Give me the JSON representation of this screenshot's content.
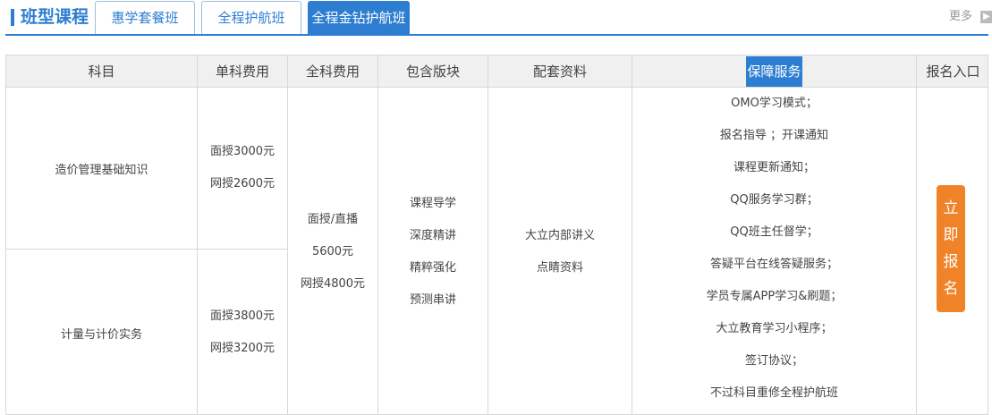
{
  "header": {
    "title": "班型课程",
    "tabs": [
      {
        "label": "惠学套餐班",
        "active": false
      },
      {
        "label": "全程护航班",
        "active": false
      },
      {
        "label": "全程金钻护航班",
        "active": true
      }
    ],
    "more_label": "更多",
    "more_arrow": "▶"
  },
  "table": {
    "columns": [
      "科目",
      "单科费用",
      "全科费用",
      "包含版块",
      "配套资料",
      "保障服务",
      "报名入口"
    ],
    "subjects": [
      {
        "name": "造价管理基础知识",
        "fees": [
          "面授3000元",
          "网授2600元"
        ]
      },
      {
        "name": "计量与计价实务",
        "fees": [
          "面授3800元",
          "网授3200元"
        ]
      }
    ],
    "all_fee": [
      "面授/直播",
      "5600元",
      "网授4800元"
    ],
    "modules": [
      "课程导学",
      "深度精讲",
      "精粹强化",
      "预测串讲"
    ],
    "materials": [
      "大立内部讲义",
      "点睛资料"
    ],
    "services": [
      "OMO学习模式；",
      "报名指导 ；开课通知",
      "课程更新通知；",
      "QQ服务学习群；",
      "QQ班主任督学；",
      "答疑平台在线答疑服务；",
      "学员专属APP学习&刷题；",
      "大立教育学习小程序；",
      "签订协议；",
      "不过科目重修全程护航班"
    ],
    "enroll_chars": [
      "立",
      "即",
      "报",
      "名"
    ]
  },
  "colors": {
    "accent": "#2d7ed1",
    "enroll": "#f08327",
    "header_bg": "#f0f0f0",
    "border": "#d8d8d8"
  }
}
